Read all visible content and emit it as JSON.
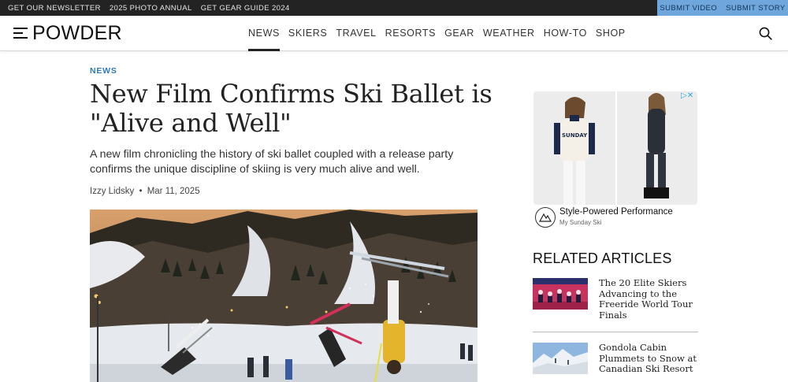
{
  "utility_bar": {
    "links": [
      "GET OUR NEWSLETTER",
      "2025 PHOTO ANNUAL",
      "GET GEAR GUIDE 2024"
    ],
    "actions": [
      "SUBMIT VIDEO",
      "SUBMIT STORY"
    ]
  },
  "header": {
    "logo": "POWDER",
    "nav": [
      "NEWS",
      "SKIERS",
      "TRAVEL",
      "RESORTS",
      "GEAR",
      "WEATHER",
      "HOW-TO",
      "SHOP"
    ],
    "active_nav": "NEWS",
    "icons": [
      "menu-icon",
      "search-icon"
    ]
  },
  "article": {
    "category": "NEWS",
    "headline": "New Film Confirms Ski Ballet is \"Alive and Well\"",
    "dek": "A new film chronicling the history of ski ballet coupled with a release party confirms the unique discipline of skiing is very much alive and well.",
    "author": "Izzy Lidsky",
    "separator": "•",
    "date": "Mar 11, 2025"
  },
  "ad": {
    "title": "Style-Powered Performance",
    "brand": "My Sunday Ski",
    "choices_icon": "ad-choices-icon",
    "sweater_text": "SUNDAY"
  },
  "related": {
    "heading": "RELATED ARTICLES",
    "items": [
      {
        "title": "The 20 Elite Skiers Advancing to the Freeride World Tour Finals"
      },
      {
        "title": "Gondola Cabin Plummets to Snow at Canadian Ski Resort"
      }
    ]
  },
  "colors": {
    "accent": "#2f7ab8",
    "submit_bar": "#6fa6db",
    "topbar": "#232323"
  }
}
